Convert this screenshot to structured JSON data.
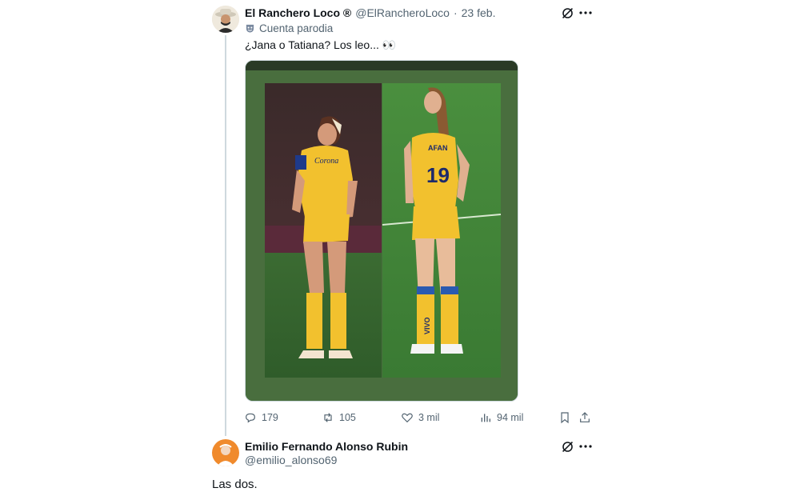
{
  "tweet1": {
    "display_name": "El Ranchero Loco ®",
    "handle": "@ElRancheroLoco",
    "separator": "·",
    "date": "23 feb.",
    "parody_label": "Cuenta parodia",
    "text": "¿Jana o Tatiana? Los leo... 👀",
    "avatar_icon": "cowboy-avatar-icon",
    "parody_icon": "parody-mask-icon",
    "media_left_shirt_text": "Corona",
    "media_right_shirt_number": "19",
    "media_right_shirt_name": "AFAN",
    "media_right_sock_text": "VIVO",
    "actions": {
      "replies": "179",
      "retweets": "105",
      "likes": "3 mil",
      "views": "94 mil"
    }
  },
  "tweet2": {
    "display_name": "Emilio Fernando Alonso Rubin",
    "handle": "@emilio_alonso69",
    "text": "Las dos.",
    "avatar_icon": "orange-avatar-icon"
  },
  "colors": {
    "text_primary": "#0f1419",
    "text_secondary": "#536471",
    "thread_line": "#cfd9de",
    "jersey_yellow": "#f2c12e",
    "pitch_green": "#3f8a3a"
  }
}
